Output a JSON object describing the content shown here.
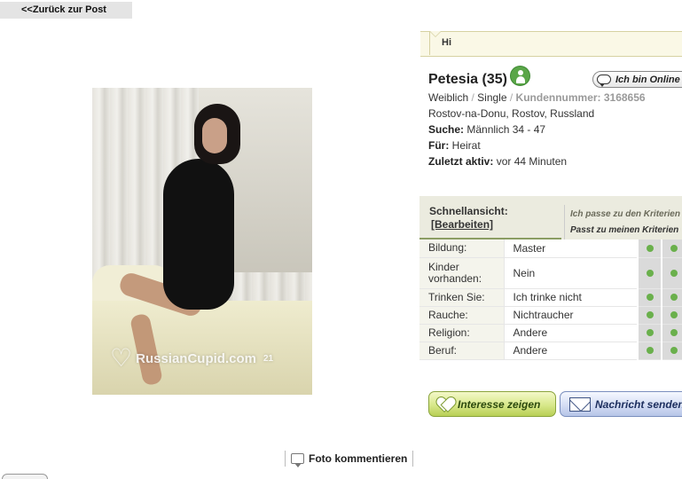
{
  "nav": {
    "back_label": "<<Zurück zur Post"
  },
  "photo": {
    "watermark": "RussianCupid.com",
    "age_tag": "21"
  },
  "greeting": {
    "text": "Hi"
  },
  "profile": {
    "name": "Petesia (35)",
    "online_label": "Ich bin Online",
    "gender": "Weiblich",
    "status": "Single",
    "customer_number_label": "Kundennummer: 3168656",
    "location": "Rostov-na-Donu, Rostov, Russland",
    "search_label": "Suche:",
    "search_value": "Männlich 34 - 47",
    "for_label": "Für:",
    "for_value": "Heirat",
    "last_active_label": "Zuletzt aktiv:",
    "last_active_value": "vor 44 Minuten"
  },
  "quickview": {
    "title": "Schnellansicht:",
    "edit_label": "[Bearbeiten]",
    "criteria_1": "Ich passe zu den Kriterien",
    "criteria_2": "Passt zu meinen Kriterien",
    "rows": [
      {
        "label": "Bildung:",
        "value": "Master"
      },
      {
        "label": "Kinder vorhanden:",
        "value": "Nein"
      },
      {
        "label": "Trinken Sie:",
        "value": "Ich trinke nicht"
      },
      {
        "label": "Rauche:",
        "value": "Nichtraucher"
      },
      {
        "label": "Religion:",
        "value": "Andere"
      },
      {
        "label": "Beruf:",
        "value": "Andere"
      }
    ]
  },
  "actions": {
    "interest_label": "Interesse zeigen",
    "message_label": "Nachricht senden",
    "comment_photo_label": "Foto kommentieren"
  },
  "colors": {
    "match_dot": "#6ab04c",
    "interest_button": "#d7e88a",
    "message_button": "#d5def4",
    "online_icon": "#5aa648"
  },
  "icons": [
    "heart-icon",
    "envelope-icon",
    "speech-bubble-icon",
    "person-icon",
    "comment-icon"
  ]
}
